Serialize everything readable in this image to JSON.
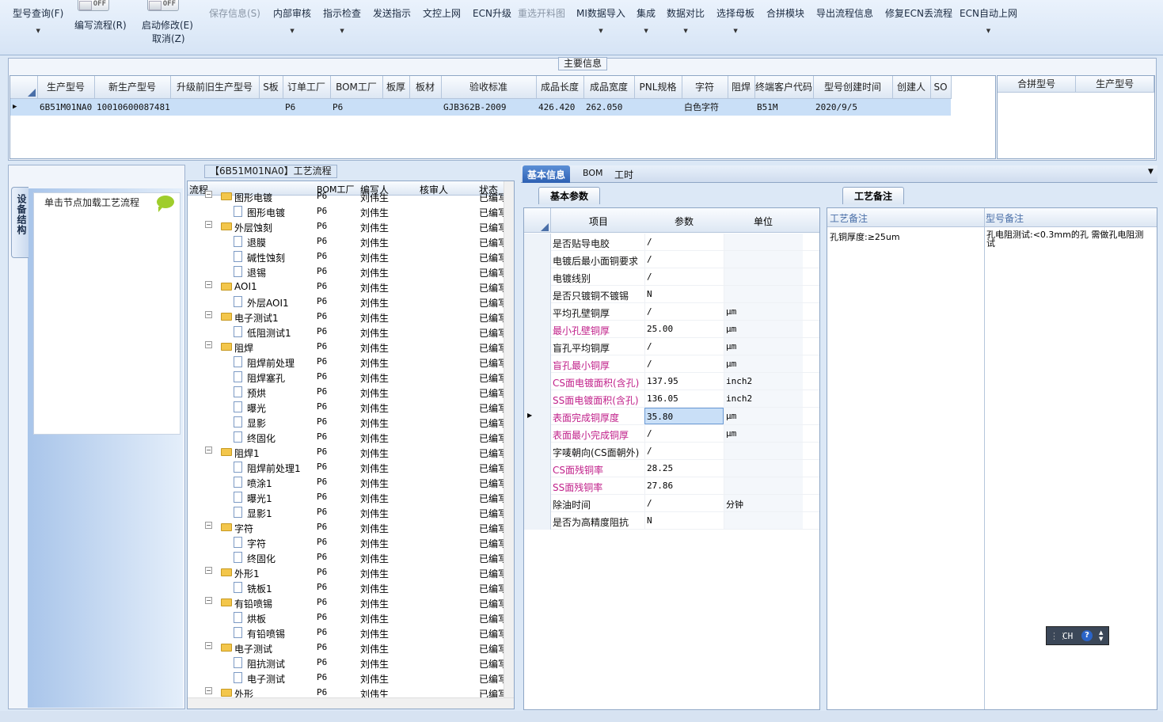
{
  "toolbar": {
    "model_query": "型号查询(F)",
    "write_flow": "编写流程(R)",
    "start_modify": "启动修改(E)",
    "cancel": "取消(Z)",
    "off": "OFF",
    "save_info": "保存信息(S)",
    "internal_review": "内部审核",
    "instruction_check": "指示检查",
    "send_instruction": "发送指示",
    "doc_upload": "文控上网",
    "ecn_upgrade": "ECN升级",
    "reselect_chart": "重选开料图",
    "mi_import": "MI数据导入",
    "integrate": "集成",
    "data_compare": "数据对比",
    "select_mother": "选择母板",
    "merge_module": "合拼模块",
    "export_flow": "导出流程信息",
    "fix_ecn": "修复ECN丢流程",
    "ecn_auto": "ECN自动上网"
  },
  "main_info": {
    "title": "主要信息",
    "columns": [
      "生产型号",
      "新生产型号",
      "升级前旧生产型号",
      "S板",
      "订单工厂",
      "BOM工厂",
      "板厚",
      "板材",
      "验收标准",
      "成品长度",
      "成品宽度",
      "PNL规格",
      "字符",
      "阻焊",
      "终端客户代码",
      "型号创建时间",
      "创建人",
      "SO"
    ],
    "row": [
      "6B51M01NA0",
      "10010600087481",
      "",
      "",
      "P6",
      "P6",
      "",
      "",
      "GJB362B-2009",
      "426.420",
      "262.050",
      "",
      "白色字符",
      "",
      "B51M",
      "2020/9/5",
      "",
      ""
    ],
    "side_columns": [
      "合拼型号",
      "生产型号"
    ]
  },
  "left": {
    "vtab": "设备结构",
    "node_hint": "单击节点加载工艺流程"
  },
  "flow": {
    "title": "【6B51M01NA0】工艺流程",
    "headers": [
      "流程",
      "BOM工厂",
      "编写人",
      "核审人",
      "状态"
    ],
    "rows": [
      {
        "name": "图形电镀",
        "lv": 0,
        "f": "P6",
        "w": "刘伟生",
        "s": "已编写"
      },
      {
        "name": "图形电镀",
        "lv": 1,
        "f": "P6",
        "w": "刘伟生",
        "s": "已编写"
      },
      {
        "name": "外层蚀刻",
        "lv": 0,
        "f": "P6",
        "w": "刘伟生",
        "s": "已编写"
      },
      {
        "name": "退膜",
        "lv": 1,
        "f": "P6",
        "w": "刘伟生",
        "s": "已编写"
      },
      {
        "name": "碱性蚀刻",
        "lv": 1,
        "f": "P6",
        "w": "刘伟生",
        "s": "已编写"
      },
      {
        "name": "退锡",
        "lv": 1,
        "f": "P6",
        "w": "刘伟生",
        "s": "已编写"
      },
      {
        "name": "AOI1",
        "lv": 0,
        "f": "P6",
        "w": "刘伟生",
        "s": "已编写"
      },
      {
        "name": "外层AOI1",
        "lv": 1,
        "f": "P6",
        "w": "刘伟生",
        "s": "已编写"
      },
      {
        "name": "电子测试1",
        "lv": 0,
        "f": "P6",
        "w": "刘伟生",
        "s": "已编写"
      },
      {
        "name": "低阻测试1",
        "lv": 1,
        "f": "P6",
        "w": "刘伟生",
        "s": "已编写"
      },
      {
        "name": "阻焊",
        "lv": 0,
        "f": "P6",
        "w": "刘伟生",
        "s": "已编写"
      },
      {
        "name": "阻焊前处理",
        "lv": 1,
        "f": "P6",
        "w": "刘伟生",
        "s": "已编写"
      },
      {
        "name": "阻焊塞孔",
        "lv": 1,
        "f": "P6",
        "w": "刘伟生",
        "s": "已编写"
      },
      {
        "name": "预烘",
        "lv": 1,
        "f": "P6",
        "w": "刘伟生",
        "s": "已编写"
      },
      {
        "name": "曝光",
        "lv": 1,
        "f": "P6",
        "w": "刘伟生",
        "s": "已编写"
      },
      {
        "name": "显影",
        "lv": 1,
        "f": "P6",
        "w": "刘伟生",
        "s": "已编写"
      },
      {
        "name": "终固化",
        "lv": 1,
        "f": "P6",
        "w": "刘伟生",
        "s": "已编写"
      },
      {
        "name": "阻焊1",
        "lv": 0,
        "f": "P6",
        "w": "刘伟生",
        "s": "已编写"
      },
      {
        "name": "阻焊前处理1",
        "lv": 1,
        "f": "P6",
        "w": "刘伟生",
        "s": "已编写"
      },
      {
        "name": "喷涂1",
        "lv": 1,
        "f": "P6",
        "w": "刘伟生",
        "s": "已编写"
      },
      {
        "name": "曝光1",
        "lv": 1,
        "f": "P6",
        "w": "刘伟生",
        "s": "已编写"
      },
      {
        "name": "显影1",
        "lv": 1,
        "f": "P6",
        "w": "刘伟生",
        "s": "已编写"
      },
      {
        "name": "字符",
        "lv": 0,
        "f": "P6",
        "w": "刘伟生",
        "s": "已编写"
      },
      {
        "name": "字符",
        "lv": 1,
        "f": "P6",
        "w": "刘伟生",
        "s": "已编写"
      },
      {
        "name": "终固化",
        "lv": 1,
        "f": "P6",
        "w": "刘伟生",
        "s": "已编写"
      },
      {
        "name": "外形1",
        "lv": 0,
        "f": "P6",
        "w": "刘伟生",
        "s": "已编写"
      },
      {
        "name": "铣板1",
        "lv": 1,
        "f": "P6",
        "w": "刘伟生",
        "s": "已编写"
      },
      {
        "name": "有铅喷锡",
        "lv": 0,
        "f": "P6",
        "w": "刘伟生",
        "s": "已编写"
      },
      {
        "name": "烘板",
        "lv": 1,
        "f": "P6",
        "w": "刘伟生",
        "s": "已编写"
      },
      {
        "name": "有铅喷锡",
        "lv": 1,
        "f": "P6",
        "w": "刘伟生",
        "s": "已编写"
      },
      {
        "name": "电子测试",
        "lv": 0,
        "f": "P6",
        "w": "刘伟生",
        "s": "已编写"
      },
      {
        "name": "阻抗测试",
        "lv": 1,
        "f": "P6",
        "w": "刘伟生",
        "s": "已编写"
      },
      {
        "name": "电子测试",
        "lv": 1,
        "f": "P6",
        "w": "刘伟生",
        "s": "已编写"
      },
      {
        "name": "外形",
        "lv": 0,
        "f": "P6",
        "w": "刘伟生",
        "s": "已编写"
      }
    ]
  },
  "tabs": {
    "basic": "基本信息",
    "bom": "BOM",
    "process": "工时"
  },
  "params": {
    "sub_tab": "基本参数",
    "headers": [
      "项目",
      "参数",
      "单位"
    ],
    "rows": [
      {
        "item": "是否贴导电胶",
        "val": "/",
        "unit": "",
        "pink": false
      },
      {
        "item": "电镀后最小面铜要求",
        "val": "/",
        "unit": "",
        "pink": false
      },
      {
        "item": "电镀线别",
        "val": "/",
        "unit": "",
        "pink": false
      },
      {
        "item": "是否只镀铜不镀锡",
        "val": "N",
        "unit": "",
        "pink": false
      },
      {
        "item": "平均孔壁铜厚",
        "val": "/",
        "unit": "μm",
        "pink": false
      },
      {
        "item": "最小孔壁铜厚",
        "val": "25.00",
        "unit": "μm",
        "pink": true
      },
      {
        "item": "盲孔平均铜厚",
        "val": "/",
        "unit": "μm",
        "pink": false
      },
      {
        "item": "盲孔最小铜厚",
        "val": "/",
        "unit": "μm",
        "pink": true
      },
      {
        "item": "CS面电镀面积(含孔)",
        "val": "137.95",
        "unit": "inch2",
        "pink": true
      },
      {
        "item": "SS面电镀面积(含孔)",
        "val": "136.05",
        "unit": "inch2",
        "pink": true
      },
      {
        "item": "表面完成铜厚度",
        "val": "35.80",
        "unit": "μm",
        "pink": true
      },
      {
        "item": "表面最小完成铜厚",
        "val": "/",
        "unit": "μm",
        "pink": true
      },
      {
        "item": "字唛朝向(CS面朝外)",
        "val": "/",
        "unit": "",
        "pink": false
      },
      {
        "item": "CS面残铜率",
        "val": "28.25",
        "unit": "",
        "pink": true
      },
      {
        "item": "SS面残铜率",
        "val": "27.86",
        "unit": "",
        "pink": true
      },
      {
        "item": "除油时间",
        "val": "/",
        "unit": "分钟",
        "pink": false
      },
      {
        "item": "是否为高精度阻抗",
        "val": "N",
        "unit": "",
        "pink": false
      }
    ]
  },
  "notes": {
    "sub_tab": "工艺备注",
    "h1": "工艺备注",
    "h2": "型号备注",
    "craft_note": "孔铜厚度:≥25um",
    "model_note": "孔电阻测试:<0.3mm的孔 需做孔电阻测试"
  },
  "ime": {
    "label": "CH"
  }
}
